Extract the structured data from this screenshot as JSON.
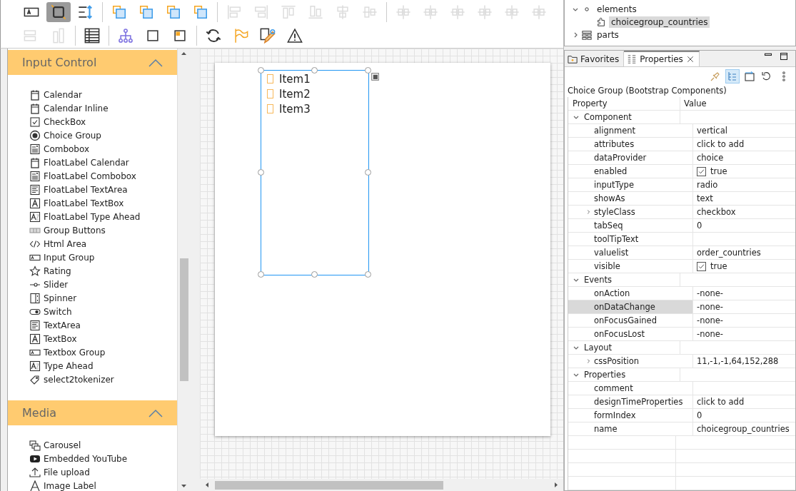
{
  "toolbar": {
    "rows": [
      [
        [
          {
            "kind": "labelbox",
            "disabled": false,
            "pressed": false
          },
          {
            "kind": "select",
            "disabled": false,
            "pressed": true
          },
          {
            "kind": "resize",
            "disabled": false,
            "pressed": false
          }
        ],
        [
          {
            "kind": "layer",
            "disabled": false,
            "pressed": false
          },
          {
            "kind": "layer",
            "disabled": false,
            "pressed": false
          },
          {
            "kind": "layer",
            "disabled": false,
            "pressed": false
          },
          {
            "kind": "layer",
            "disabled": false,
            "pressed": false
          }
        ],
        [
          {
            "kind": "alignleft",
            "disabled": true,
            "pressed": false
          },
          {
            "kind": "alignright",
            "disabled": true,
            "pressed": false
          },
          {
            "kind": "aligntop",
            "disabled": true,
            "pressed": false
          },
          {
            "kind": "alignbottom",
            "disabled": true,
            "pressed": false
          },
          {
            "kind": "centerh",
            "disabled": true,
            "pressed": false
          },
          {
            "kind": "centerv",
            "disabled": true,
            "pressed": false
          }
        ],
        [
          {
            "kind": "distribute",
            "disabled": true,
            "pressed": false
          },
          {
            "kind": "distribute",
            "disabled": true,
            "pressed": false
          },
          {
            "kind": "distribute",
            "disabled": true,
            "pressed": false
          },
          {
            "kind": "distribute",
            "disabled": true,
            "pressed": false
          },
          {
            "kind": "distribute",
            "disabled": true,
            "pressed": false
          },
          {
            "kind": "distribute",
            "disabled": true,
            "pressed": false
          }
        ]
      ],
      [
        [
          {
            "kind": "samewidth",
            "disabled": true,
            "pressed": false
          },
          {
            "kind": "sameheight",
            "disabled": true,
            "pressed": false
          }
        ],
        [
          {
            "kind": "table",
            "disabled": false,
            "pressed": false
          }
        ],
        [
          {
            "kind": "hierarchy",
            "disabled": false,
            "pressed": false
          },
          {
            "kind": "frame",
            "disabled": false,
            "pressed": false
          },
          {
            "kind": "anchor",
            "disabled": false,
            "pressed": false
          }
        ],
        [
          {
            "kind": "refresh",
            "disabled": false,
            "pressed": false
          },
          {
            "kind": "flag",
            "disabled": false,
            "pressed": false
          },
          {
            "kind": "pencil",
            "disabled": false,
            "pressed": false
          },
          {
            "kind": "warning",
            "disabled": false,
            "pressed": false
          }
        ]
      ]
    ]
  },
  "palette": {
    "sections": [
      {
        "title": "Input Control",
        "expanded": true,
        "items": [
          {
            "label": "Calendar",
            "kind": "calendar"
          },
          {
            "label": "Calendar Inline",
            "kind": "calendar"
          },
          {
            "label": "CheckBox",
            "kind": "checkbox"
          },
          {
            "label": "Choice Group",
            "kind": "radio"
          },
          {
            "label": "Combobox",
            "kind": "combobox"
          },
          {
            "label": "FloatLabel Calendar",
            "kind": "calendar"
          },
          {
            "label": "FloatLabel Combobox",
            "kind": "combobox"
          },
          {
            "label": "FloatLabel TextArea",
            "kind": "textarea"
          },
          {
            "label": "FloatLabel TextBox",
            "kind": "textbox"
          },
          {
            "label": "FloatLabel Type Ahead",
            "kind": "typeahead"
          },
          {
            "label": "Group Buttons",
            "kind": "buttons"
          },
          {
            "label": "Html Area",
            "kind": "code"
          },
          {
            "label": "Input Group",
            "kind": "inputgroup"
          },
          {
            "label": "Rating",
            "kind": "star"
          },
          {
            "label": "Slider",
            "kind": "slider"
          },
          {
            "label": "Spinner",
            "kind": "spinner"
          },
          {
            "label": "Switch",
            "kind": "switch"
          },
          {
            "label": "TextArea",
            "kind": "textarea"
          },
          {
            "label": "TextBox",
            "kind": "textbox"
          },
          {
            "label": "Textbox Group",
            "kind": "inputgroup"
          },
          {
            "label": "Type Ahead",
            "kind": "typeahead"
          },
          {
            "label": "select2tokenizer",
            "kind": "tag"
          }
        ]
      },
      {
        "title": "Media",
        "expanded": true,
        "items": [
          {
            "label": "Carousel",
            "kind": "carousel"
          },
          {
            "label": "Embedded YouTube",
            "kind": "video"
          },
          {
            "label": "File upload",
            "kind": "upload"
          },
          {
            "label": "Image Label",
            "kind": "letter"
          }
        ]
      }
    ]
  },
  "canvas": {
    "component": {
      "selected": true,
      "items": [
        {
          "label": "Item1",
          "checked": false
        },
        {
          "label": "Item2",
          "checked": false
        },
        {
          "label": "Item3",
          "checked": false
        }
      ]
    }
  },
  "outline": {
    "nodes": [
      {
        "label": "elements",
        "kind": "dot",
        "expanded": true,
        "selected": false,
        "children": [
          {
            "label": "choicegroup_countries",
            "kind": "puzzle",
            "selected": true
          }
        ]
      },
      {
        "label": "parts",
        "kind": "parts",
        "expanded": false,
        "selected": false
      }
    ]
  },
  "properties": {
    "tabs": [
      {
        "label": "Favorites",
        "kind": "folder",
        "selected": false,
        "closable": false
      },
      {
        "label": "Properties",
        "kind": "props",
        "selected": true,
        "closable": true
      }
    ],
    "tools": [
      {
        "kind": "pin",
        "pressed": false
      },
      {
        "kind": "tree",
        "pressed": true
      },
      {
        "kind": "link",
        "pressed": false
      },
      {
        "kind": "undo",
        "pressed": false
      },
      {
        "kind": "more",
        "pressed": false
      }
    ],
    "title": "Choice Group (Bootstrap Components)",
    "columns": [
      "Property",
      "Value"
    ],
    "groups": [
      {
        "label": "Component",
        "expanded": true,
        "rows": [
          {
            "name": "alignment",
            "value": "vertical",
            "kind": "text",
            "selected": false
          },
          {
            "name": "attributes",
            "value": "click to add",
            "kind": "text",
            "selected": false
          },
          {
            "name": "dataProvider",
            "value": "choice",
            "kind": "text",
            "selected": false
          },
          {
            "name": "enabled",
            "value": "true",
            "kind": "checkbox",
            "checked": true,
            "selected": false
          },
          {
            "name": "inputType",
            "value": "radio",
            "kind": "text",
            "selected": false
          },
          {
            "name": "showAs",
            "value": "text",
            "kind": "text",
            "selected": false
          },
          {
            "name": "styleClass",
            "value": "checkbox",
            "kind": "text",
            "expanded": false,
            "selected": false
          },
          {
            "name": "tabSeq",
            "value": "0",
            "kind": "text",
            "selected": false
          },
          {
            "name": "toolTipText",
            "kind": "text",
            "selected": false
          },
          {
            "name": "valuelist",
            "value": "order_countries",
            "kind": "text",
            "selected": false
          },
          {
            "name": "visible",
            "value": "true",
            "kind": "checkbox",
            "checked": true,
            "selected": false
          }
        ]
      },
      {
        "label": "Events",
        "expanded": true,
        "rows": [
          {
            "name": "onAction",
            "value": "-none-",
            "kind": "text",
            "selected": false
          },
          {
            "name": "onDataChange",
            "value": "-none-",
            "kind": "text",
            "selected": true
          },
          {
            "name": "onFocusGained",
            "value": "-none-",
            "kind": "text",
            "selected": false
          },
          {
            "name": "onFocusLost",
            "value": "-none-",
            "kind": "text",
            "selected": false
          }
        ]
      },
      {
        "label": "Layout",
        "expanded": true,
        "rows": [
          {
            "name": "cssPosition",
            "value": "11,-1,-1,64,152,288",
            "kind": "text",
            "expanded": false,
            "selected": false
          }
        ]
      },
      {
        "label": "Properties",
        "expanded": true,
        "rows": [
          {
            "name": "comment",
            "kind": "text",
            "selected": false
          },
          {
            "name": "designTimeProperties",
            "value": "click to add",
            "kind": "text",
            "selected": false
          },
          {
            "name": "formIndex",
            "value": "0",
            "kind": "text",
            "selected": false
          },
          {
            "name": "name",
            "value": "choicegroup_countries",
            "kind": "text",
            "selected": false
          }
        ]
      }
    ]
  }
}
